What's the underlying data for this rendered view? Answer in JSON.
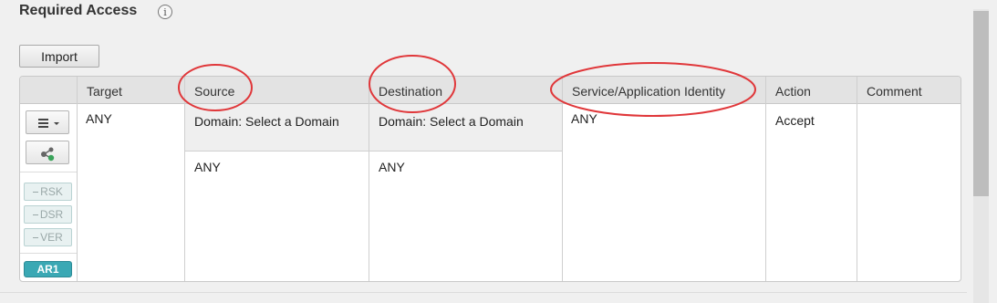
{
  "section": {
    "title": "Required Access",
    "info_icon": "i"
  },
  "toolbar": {
    "import_label": "Import"
  },
  "table": {
    "headers": {
      "target": "Target",
      "source": "Source",
      "destination": "Destination",
      "service": "Service/Application Identity",
      "action": "Action",
      "comment": "Comment"
    },
    "row": {
      "target": "ANY",
      "source_domain": "Domain:  Select a Domain",
      "source_value": "ANY",
      "destination_domain": "Domain:  Select a Domain",
      "destination_value": "ANY",
      "service": "ANY",
      "action": "Accept",
      "comment": ""
    },
    "tags": {
      "rsk": "RSK",
      "dsr": "DSR",
      "ver": "VER",
      "ar1": "AR1"
    }
  },
  "colors": {
    "annotation_circle": "#e0373a",
    "ar1_badge": "#3aa8b4"
  },
  "icons": [
    "info-icon",
    "menu-icon",
    "dropdown-caret-icon",
    "connect-icon"
  ]
}
